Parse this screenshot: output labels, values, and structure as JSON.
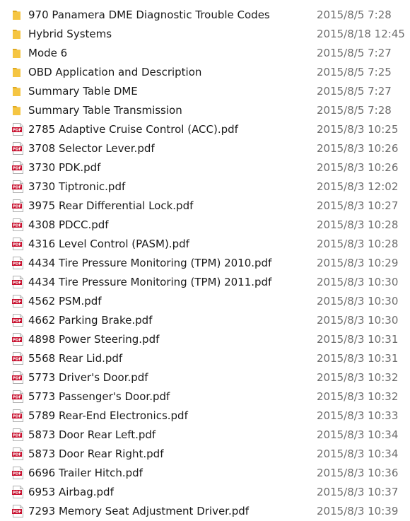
{
  "colors": {
    "folder": "#f5c542",
    "pdf": "#c8102e",
    "name_text": "#1a1a1a",
    "date_text": "#6d6d6d"
  },
  "files": [
    {
      "type": "folder",
      "icon": "folder-icon",
      "name": "970 Panamera DME Diagnostic Trouble Codes",
      "modified": "2015/8/5 7:28"
    },
    {
      "type": "folder",
      "icon": "folder-icon",
      "name": "Hybrid Systems",
      "modified": "2015/8/18 12:45"
    },
    {
      "type": "folder",
      "icon": "folder-icon",
      "name": "Mode 6",
      "modified": "2015/8/5 7:27"
    },
    {
      "type": "folder",
      "icon": "folder-icon",
      "name": "OBD Application and Description",
      "modified": "2015/8/5 7:25"
    },
    {
      "type": "folder",
      "icon": "folder-icon",
      "name": "Summary Table DME",
      "modified": "2015/8/5 7:27"
    },
    {
      "type": "folder",
      "icon": "folder-icon",
      "name": "Summary Table Transmission",
      "modified": "2015/8/5 7:28"
    },
    {
      "type": "pdf",
      "icon": "pdf-icon",
      "icon_text": "PDF",
      "name": "2785 Adaptive Cruise Control (ACC).pdf",
      "modified": "2015/8/3 10:25"
    },
    {
      "type": "pdf",
      "icon": "pdf-icon",
      "icon_text": "PDF",
      "name": "3708 Selector Lever.pdf",
      "modified": "2015/8/3 10:26"
    },
    {
      "type": "pdf",
      "icon": "pdf-icon",
      "icon_text": "PDF",
      "name": "3730 PDK.pdf",
      "modified": "2015/8/3 10:26"
    },
    {
      "type": "pdf",
      "icon": "pdf-icon",
      "icon_text": "PDF",
      "name": "3730 Tiptronic.pdf",
      "modified": "2015/8/3 12:02"
    },
    {
      "type": "pdf",
      "icon": "pdf-icon",
      "icon_text": "PDF",
      "name": "3975 Rear Differential Lock.pdf",
      "modified": "2015/8/3 10:27"
    },
    {
      "type": "pdf",
      "icon": "pdf-icon",
      "icon_text": "PDF",
      "name": "4308 PDCC.pdf",
      "modified": "2015/8/3 10:28"
    },
    {
      "type": "pdf",
      "icon": "pdf-icon",
      "icon_text": "PDF",
      "name": "4316 Level Control (PASM).pdf",
      "modified": "2015/8/3 10:28"
    },
    {
      "type": "pdf",
      "icon": "pdf-icon",
      "icon_text": "PDF",
      "name": "4434 Tire Pressure Monitoring (TPM) 2010.pdf",
      "modified": "2015/8/3 10:29"
    },
    {
      "type": "pdf",
      "icon": "pdf-icon",
      "icon_text": "PDF",
      "name": "4434 Tire Pressure Monitoring (TPM) 2011.pdf",
      "modified": "2015/8/3 10:30"
    },
    {
      "type": "pdf",
      "icon": "pdf-icon",
      "icon_text": "PDF",
      "name": "4562 PSM.pdf",
      "modified": "2015/8/3 10:30"
    },
    {
      "type": "pdf",
      "icon": "pdf-icon",
      "icon_text": "PDF",
      "name": "4662 Parking Brake.pdf",
      "modified": "2015/8/3 10:30"
    },
    {
      "type": "pdf",
      "icon": "pdf-icon",
      "icon_text": "PDF",
      "name": "4898 Power Steering.pdf",
      "modified": "2015/8/3 10:31"
    },
    {
      "type": "pdf",
      "icon": "pdf-icon",
      "icon_text": "PDF",
      "name": "5568 Rear Lid.pdf",
      "modified": "2015/8/3 10:31"
    },
    {
      "type": "pdf",
      "icon": "pdf-icon",
      "icon_text": "PDF",
      "name": "5773 Driver's Door.pdf",
      "modified": "2015/8/3 10:32"
    },
    {
      "type": "pdf",
      "icon": "pdf-icon",
      "icon_text": "PDF",
      "name": "5773 Passenger's Door.pdf",
      "modified": "2015/8/3 10:32"
    },
    {
      "type": "pdf",
      "icon": "pdf-icon",
      "icon_text": "PDF",
      "name": "5789 Rear-End Electronics.pdf",
      "modified": "2015/8/3 10:33"
    },
    {
      "type": "pdf",
      "icon": "pdf-icon",
      "icon_text": "PDF",
      "name": "5873 Door Rear Left.pdf",
      "modified": "2015/8/3 10:34"
    },
    {
      "type": "pdf",
      "icon": "pdf-icon",
      "icon_text": "PDF",
      "name": "5873 Door Rear Right.pdf",
      "modified": "2015/8/3 10:34"
    },
    {
      "type": "pdf",
      "icon": "pdf-icon",
      "icon_text": "PDF",
      "name": "6696 Trailer Hitch.pdf",
      "modified": "2015/8/3 10:36"
    },
    {
      "type": "pdf",
      "icon": "pdf-icon",
      "icon_text": "PDF",
      "name": "6953 Airbag.pdf",
      "modified": "2015/8/3 10:37"
    },
    {
      "type": "pdf",
      "icon": "pdf-icon",
      "icon_text": "PDF",
      "name": "7293 Memory Seat Adjustment Driver.pdf",
      "modified": "2015/8/3 10:39"
    }
  ]
}
